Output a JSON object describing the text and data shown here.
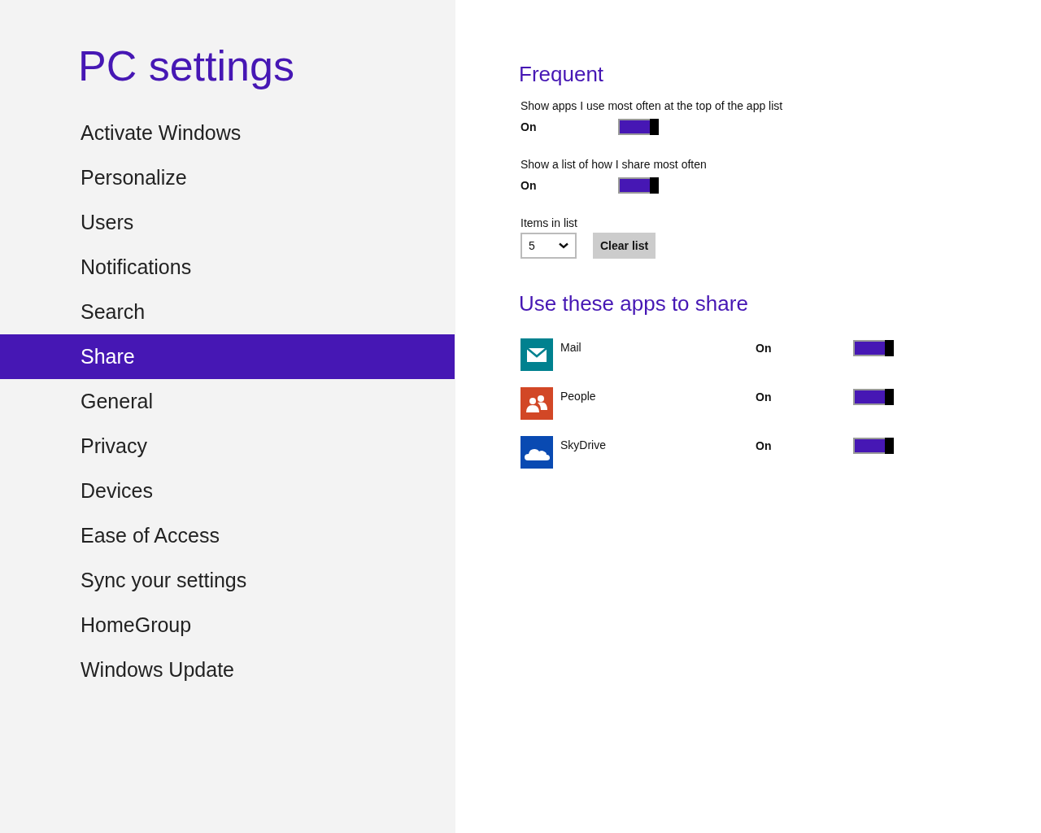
{
  "sidebar": {
    "title": "PC settings",
    "items": [
      {
        "label": "Activate Windows",
        "selected": false
      },
      {
        "label": "Personalize",
        "selected": false
      },
      {
        "label": "Users",
        "selected": false
      },
      {
        "label": "Notifications",
        "selected": false
      },
      {
        "label": "Search",
        "selected": false
      },
      {
        "label": "Share",
        "selected": true
      },
      {
        "label": "General",
        "selected": false
      },
      {
        "label": "Privacy",
        "selected": false
      },
      {
        "label": "Devices",
        "selected": false
      },
      {
        "label": "Ease of Access",
        "selected": false
      },
      {
        "label": "Sync your settings",
        "selected": false
      },
      {
        "label": "HomeGroup",
        "selected": false
      },
      {
        "label": "Windows Update",
        "selected": false
      }
    ]
  },
  "frequent": {
    "heading": "Frequent",
    "settings": [
      {
        "label": "Show apps I use most often at the top of the app list",
        "state": "On",
        "on": true
      },
      {
        "label": "Show a list of how I share most often",
        "state": "On",
        "on": true
      }
    ],
    "items_in_list": {
      "label": "Items in list",
      "value": "5"
    },
    "clear_button": "Clear list"
  },
  "apps": {
    "heading": "Use these apps to share",
    "items": [
      {
        "name": "Mail",
        "kind": "mail",
        "color": "#00818f",
        "state": "On",
        "on": true
      },
      {
        "name": "People",
        "kind": "people",
        "color": "#d24726",
        "state": "On",
        "on": true
      },
      {
        "name": "SkyDrive",
        "kind": "cloud",
        "color": "#094ab2",
        "state": "On",
        "on": true
      }
    ]
  }
}
